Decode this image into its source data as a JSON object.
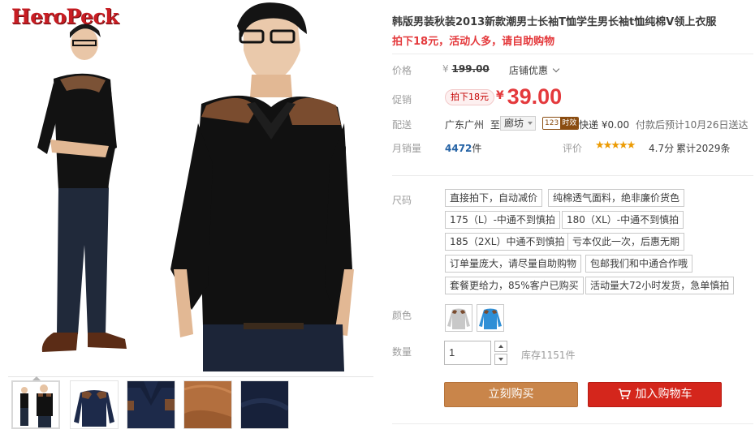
{
  "brand": {
    "logo_text": "HeroPeck"
  },
  "gallery": {
    "thumbnails": [
      "thumb-two-models",
      "thumb-shirt-navy",
      "thumb-collar-detail",
      "thumb-fabric-tan",
      "thumb-fabric-navy"
    ],
    "selected_index": 0
  },
  "product": {
    "title": "韩版男装秋装2013新款潮男士长袖T恤学生男长袖t恤纯棉V领上衣服",
    "subtitle": "拍下18元，活动人多，请自助购物"
  },
  "price_section": {
    "orig_label": "价格",
    "currency": "¥",
    "orig_price": "199.00",
    "shop_deal": "店铺优惠",
    "promo_label": "促销",
    "promo_tag": "拍下18元",
    "promo_price": "39.00"
  },
  "shipping": {
    "label": "配送",
    "from": "广东广州",
    "to_word": "至",
    "to_city": "廊坊",
    "badge_num": "123",
    "badge_text": "时效",
    "express": "快递 ¥0.00",
    "eta": "付款后预计10月26日送达"
  },
  "sales": {
    "label": "月销量",
    "count": "4472",
    "unit": "件",
    "rating_label": "评价",
    "stars": 4.7,
    "score": "4.7分",
    "reviews": "累计2029条"
  },
  "size": {
    "label": "尺码",
    "options": [
      "直接拍下，自动减价",
      "纯棉透气面料，绝非廉价货色",
      "175（L）-中通不到慎拍",
      "180（XL）-中通不到慎拍",
      "185（2XL）中通不到慎拍",
      "亏本仅此一次，后惠无期",
      "订单量庞大，请尽量自助购物",
      "包邮我们和中通合作哦",
      "套餐更给力，85%客户已购买",
      "活动量大72小时发货，急单慎拍"
    ]
  },
  "color": {
    "label": "颜色",
    "swatches": [
      {
        "name": "grey-shirt",
        "color": "#c8c8c8"
      },
      {
        "name": "blue-shirt",
        "color": "#2f8fd6"
      }
    ]
  },
  "quantity": {
    "label": "数量",
    "value": "1",
    "stock": "库存1151件"
  },
  "actions": {
    "buy_now": "立刻购买",
    "add_to_cart": "加入购物车"
  },
  "colors": {
    "accent_red": "#e4393c",
    "buy_button": "#c9854a",
    "cart_button": "#d4261c",
    "link_blue": "#2462a5"
  }
}
